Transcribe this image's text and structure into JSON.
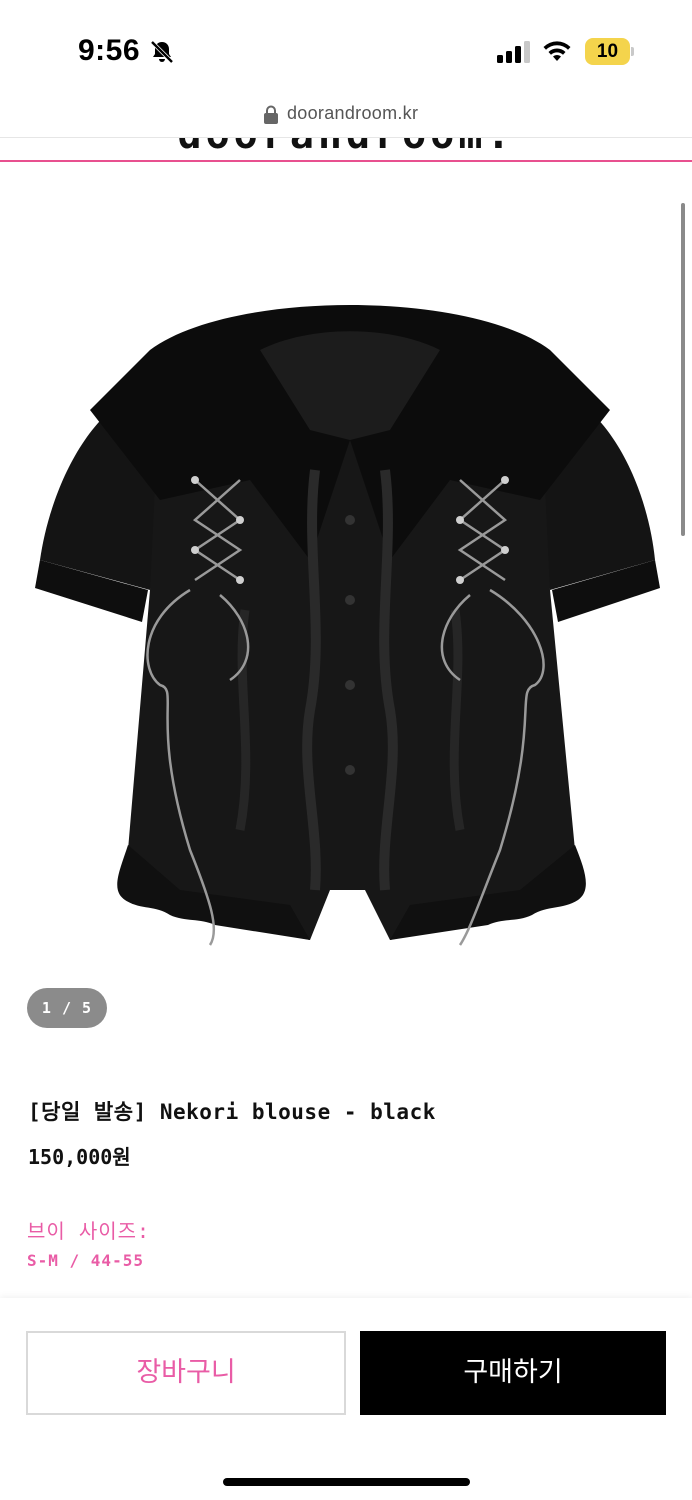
{
  "status_bar": {
    "time": "9:56",
    "battery_level": "10",
    "icons": [
      "bell-slash-icon",
      "cellular-signal-icon",
      "wifi-icon",
      "battery-icon"
    ],
    "battery_color": "#f4d44c"
  },
  "browser": {
    "url": "doorandroom.kr",
    "icon": "lock-icon"
  },
  "header": {
    "logo_text": "doorandroom."
  },
  "gallery": {
    "pager": "1 / 5",
    "image_subject": "black short-sleeve blouse with sailor collar, lace-up ties and ruffles"
  },
  "product": {
    "title": "[당일 발송] Nekori blouse - black",
    "price": "150,000원",
    "size_heading": "브이 사이즈:",
    "size_value": "S-M / 44-55"
  },
  "actions": {
    "cart_label": "장바구니",
    "buy_label": "구매하기"
  },
  "colors": {
    "accent_pink": "#e95ca6",
    "rule_pink": "#e8508f",
    "buy_button_bg": "#000000",
    "pager_bg": "#8b8b8b"
  }
}
